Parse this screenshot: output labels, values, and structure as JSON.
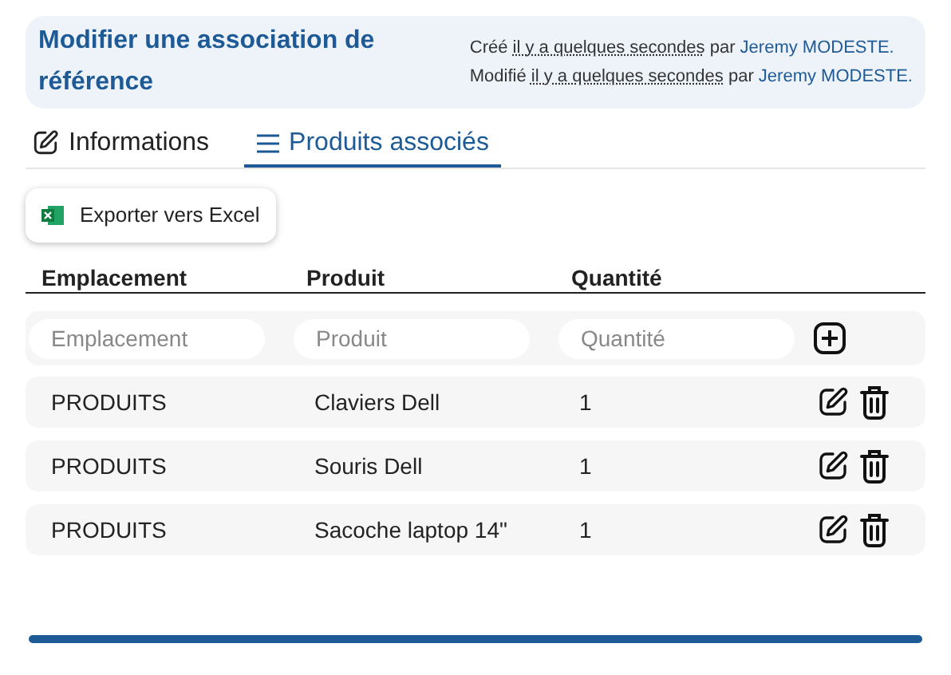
{
  "header": {
    "title": "Modifier une association de référence",
    "created": {
      "label": "Créé",
      "when": "il y a quelques secondes",
      "by": "par",
      "user": "Jeremy MODESTE."
    },
    "modified": {
      "label": "Modifié",
      "when": "il y a quelques secondes",
      "by": "par",
      "user": "Jeremy MODESTE."
    }
  },
  "tabs": [
    {
      "label": "Informations",
      "kind": "edit",
      "selected": false
    },
    {
      "label": "Produits associés",
      "kind": "list",
      "selected": true
    }
  ],
  "export_button": "Exporter vers Excel",
  "table": {
    "columns": [
      "Emplacement",
      "Produit",
      "Quantité"
    ],
    "new_row": {
      "placeholders": [
        "Emplacement",
        "Produit",
        "Quantité"
      ]
    },
    "rows": [
      {
        "cells": [
          "PRODUITS",
          "Claviers Dell",
          "1"
        ]
      },
      {
        "cells": [
          "PRODUITS",
          "Souris Dell",
          "1"
        ]
      },
      {
        "cells": [
          "PRODUITS",
          "Sacoche laptop 14\"",
          "1"
        ]
      }
    ]
  }
}
